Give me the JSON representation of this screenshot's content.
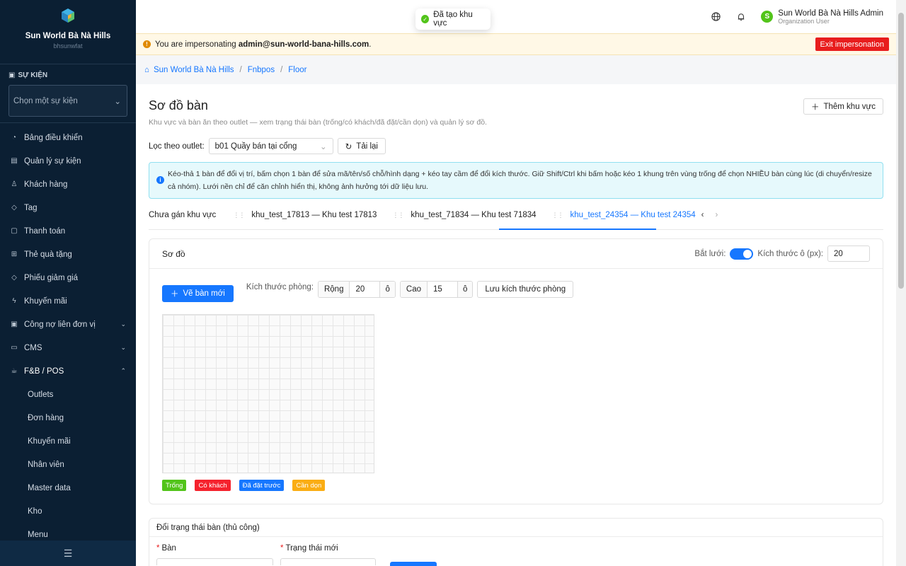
{
  "sidebar": {
    "brand_name": "Sun World Bà Nà Hills",
    "brand_sub": "bhsunwfat",
    "event_label": "SỰ KIỆN",
    "event_placeholder": "Chọn một sự kiện",
    "items": [
      {
        "label": "Bảng điều khiển",
        "icon": "dashboard-icon"
      },
      {
        "label": "Quản lý sự kiện",
        "icon": "calendar-icon"
      },
      {
        "label": "Khách hàng",
        "icon": "users-icon"
      },
      {
        "label": "Tag",
        "icon": "tag-icon"
      },
      {
        "label": "Thanh toán",
        "icon": "payment-icon"
      },
      {
        "label": "Thẻ quà tặng",
        "icon": "gift-icon"
      },
      {
        "label": "Phiếu giảm giá",
        "icon": "coupon-icon"
      },
      {
        "label": "Khuyến mãi",
        "icon": "promo-icon"
      },
      {
        "label": "Công nợ liên đơn vị",
        "icon": "debt-icon"
      },
      {
        "label": "CMS",
        "icon": "cms-icon"
      },
      {
        "label": "F&B / POS",
        "icon": "pos-icon"
      }
    ],
    "fnb_sub": [
      "Outlets",
      "Đơn hàng",
      "Khuyến mãi",
      "Nhân viên",
      "Master data",
      "Kho",
      "Menu"
    ]
  },
  "topbar": {
    "user_name": "Sun World Bà Nà Hills Admin",
    "user_role": "Organization User",
    "avatar_letter": "S"
  },
  "toast": {
    "text": "Đã tạo khu vực"
  },
  "impersonation": {
    "prefix": "You are impersonating",
    "email": "admin@sun-world-bana-hills.com",
    "suffix": ".",
    "exit_label": "Exit impersonation"
  },
  "breadcrumb": [
    "Sun World Bà Nà Hills",
    "Fnbpos",
    "Floor"
  ],
  "page": {
    "title": "Sơ đồ bàn",
    "subtitle": "Khu vực và bàn ăn theo outlet — xem trạng thái bàn (trống/có khách/đã đặt/cần dọn) và quản lý sơ đồ.",
    "add_area_label": "Thêm khu vực",
    "filter_label": "Lọc theo outlet:",
    "outlet_value": "b01 Quầy bán tại cổng",
    "reload_label": "Tải lại",
    "info_text": "Kéo-thả 1 bàn để đổi vị trí, bấm chọn 1 bàn để sửa mã/tên/số chỗ/hình dạng + kéo tay cầm để đổi kích thước. Giữ Shift/Ctrl khi bấm hoặc kéo 1 khung trên vùng trống để chọn NHIỀU bàn cùng lúc (di chuyển/resize cả nhóm). Lưới nền chỉ để căn chỉnh hiển thị, không ảnh hưởng tới dữ liệu lưu."
  },
  "tabs": [
    {
      "label": "Chưa gán khu vực"
    },
    {
      "label": "khu_test_17813 — Khu test 17813"
    },
    {
      "label": "khu_test_71834 — Khu test 71834"
    },
    {
      "label": "khu_test_24354 — Khu test 24354"
    }
  ],
  "diagram": {
    "title": "Sơ đồ",
    "snap_label": "Bắt lưới:",
    "cell_size_label": "Kích thước ô (px):",
    "cell_size_value": "20",
    "draw_table_label": "Vẽ bàn mới",
    "room_size_label": "Kích thước phòng:",
    "width_label": "Rộng",
    "width_value": "20",
    "height_label": "Cao",
    "height_value": "15",
    "unit": "ô",
    "save_room_label": "Lưu kích thước phòng",
    "legend": [
      {
        "label": "Trống",
        "color": "#52c41a"
      },
      {
        "label": "Có khách",
        "color": "#f5222d"
      },
      {
        "label": "Đã đặt trước",
        "color": "#1677ff"
      },
      {
        "label": "Cần dọn",
        "color": "#faad14"
      }
    ]
  },
  "status_form": {
    "title": "Đổi trạng thái bàn (thủ công)",
    "table_label": "Bàn",
    "new_status_label": "Trạng thái mới"
  }
}
